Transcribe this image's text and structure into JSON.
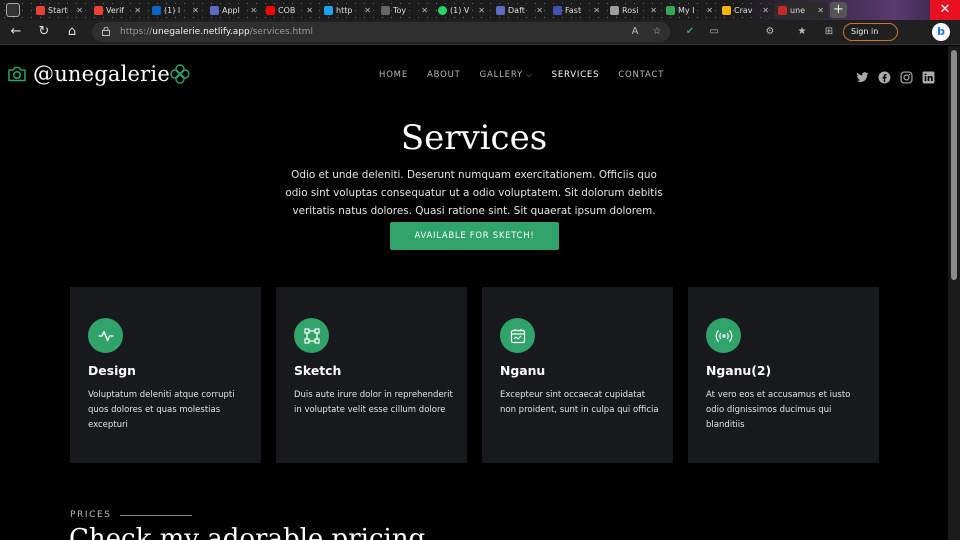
{
  "browser": {
    "tabs": [
      {
        "label": "Start",
        "color": "#e94235"
      },
      {
        "label": "Verif",
        "color": "#e94235"
      },
      {
        "label": "(1) I",
        "color": "#0a66c2"
      },
      {
        "label": "Appl",
        "color": "#5c6bc0"
      },
      {
        "label": "COB",
        "color": "#ff0000"
      },
      {
        "label": "http",
        "color": "#1da1f2"
      },
      {
        "label": "Toy",
        "color": "#666"
      },
      {
        "label": "(1) V",
        "color": "#25d366"
      },
      {
        "label": "Daft",
        "color": "#5c6bc0"
      },
      {
        "label": "Fast",
        "color": "#3f51b5"
      },
      {
        "label": "Rosi",
        "color": "#9e9e9e"
      },
      {
        "label": "My I",
        "color": "#34a853"
      },
      {
        "label": "Crav",
        "color": "#f4b400"
      },
      {
        "label": "une",
        "color": "#c62828"
      }
    ],
    "url_prefix": "https://",
    "url_host": "unegalerie.netlify.app",
    "url_path": "/services.html",
    "signin_label": "Sign in",
    "bing_label": "b"
  },
  "site": {
    "logo": "@unegalerie",
    "nav": [
      {
        "label": "HOME"
      },
      {
        "label": "ABOUT"
      },
      {
        "label": "GALLERY"
      },
      {
        "label": "SERVICES"
      },
      {
        "label": "CONTACT"
      }
    ],
    "active_nav": "SERVICES",
    "accent_color": "#2fa36a"
  },
  "hero": {
    "title": "Services",
    "text": "Odio et unde deleniti. Deserunt numquam exercitationem. Officiis quo odio sint voluptas consequatur ut a odio voluptatem. Sit dolorum debitis veritatis natus dolores. Quasi ratione sint. Sit quaerat ipsum dolorem.",
    "cta": "AVAILABLE FOR SKETCH!"
  },
  "services": [
    {
      "title": "Design",
      "icon": "activity-icon",
      "text": "Voluptatum deleniti atque corrupti quos dolores et quas molestias excepturi"
    },
    {
      "title": "Sketch",
      "icon": "bounding-box-icon",
      "text": "Duis aute irure dolor in reprehenderit in voluptate velit esse cillum dolore"
    },
    {
      "title": "Nganu",
      "icon": "calendar-icon",
      "text": "Excepteur sint occaecat cupidatat non proident, sunt in culpa qui officia"
    },
    {
      "title": "Nganu(2)",
      "icon": "broadcast-icon",
      "text": "At vero eos et accusamus et iusto odio dignissimos ducimus qui blanditiis"
    }
  ],
  "prices": {
    "label": "PRICES",
    "title": "Check my adorable pricing"
  }
}
